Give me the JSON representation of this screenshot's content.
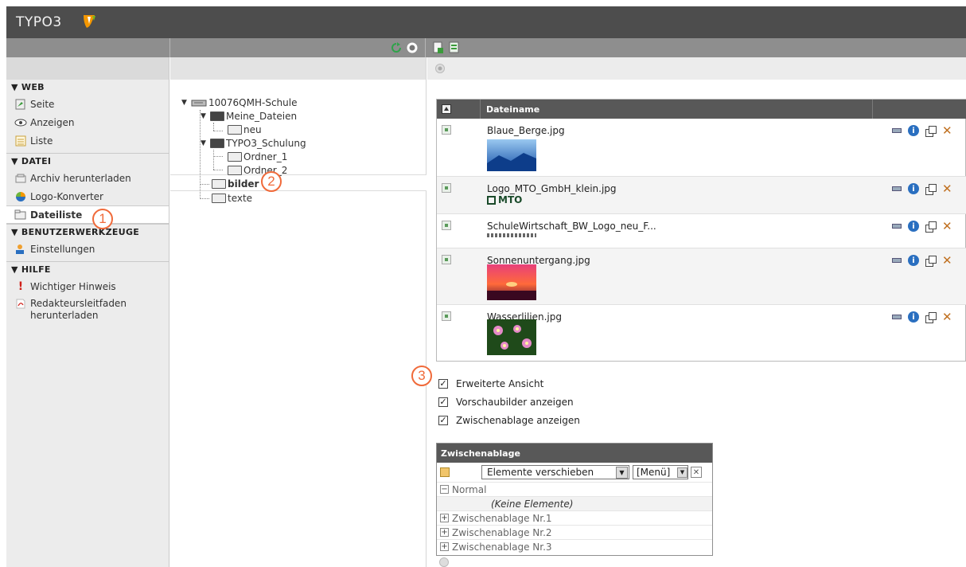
{
  "app": {
    "logo_text": "TYPO3"
  },
  "sidebar": {
    "groups": [
      {
        "title": "▼ WEB",
        "items": [
          {
            "label": "Seite",
            "icon": "page-icon"
          },
          {
            "label": "Anzeigen",
            "icon": "eye-icon"
          },
          {
            "label": "Liste",
            "icon": "list-icon"
          }
        ]
      },
      {
        "title": "▼ DATEI",
        "items": [
          {
            "label": "Archiv herunterladen",
            "icon": "archive-icon"
          },
          {
            "label": "Logo-Konverter",
            "icon": "logo-converter-icon"
          },
          {
            "label": "Dateiliste",
            "icon": "filelist-icon",
            "active": true
          }
        ]
      },
      {
        "title": "▼ BENUTZERWERKZEUGE",
        "items": [
          {
            "label": "Einstellungen",
            "icon": "user-settings-icon"
          }
        ]
      },
      {
        "title": "▼ HILFE",
        "items": [
          {
            "label": "Wichtiger Hinweis",
            "icon": "exclamation-icon"
          },
          {
            "label": "Redakteursleitfaden herunterladen",
            "icon": "pdf-icon"
          }
        ]
      }
    ]
  },
  "tree": {
    "root": "10076QMH-Schule",
    "nodes": [
      "Meine_Dateien",
      "neu",
      "TYPO3_Schulung",
      "Ordner_1",
      "Ordner_2",
      "bilder",
      "texte"
    ]
  },
  "file_table": {
    "column_header": "Dateiname",
    "rows": [
      {
        "name": "Blaue_Berge.jpg"
      },
      {
        "name": "Logo_MTO_GmbH_klein.jpg"
      },
      {
        "name": "SchuleWirtschaft_BW_Logo_neu_F..."
      },
      {
        "name": "Sonnenuntergang.jpg"
      },
      {
        "name": "Wasserlilien.jpg"
      }
    ],
    "logo_thumb_text": "MTO"
  },
  "options": [
    {
      "label": "Erweiterte Ansicht",
      "checked": true
    },
    {
      "label": "Vorschaubilder anzeigen",
      "checked": true
    },
    {
      "label": "Zwischenablage anzeigen",
      "checked": true
    }
  ],
  "clipboard": {
    "title": "Zwischenablage",
    "action_select": "Elemente verschieben",
    "menu_select": "[Menü]",
    "normal_label": "Normal",
    "empty_label": "(Keine Elemente)",
    "pads": [
      "Zwischenablage Nr.1",
      "Zwischenablage Nr.2",
      "Zwischenablage Nr.3"
    ]
  },
  "callouts": [
    "1",
    "2",
    "3"
  ],
  "colors": {
    "accent": "#f06a3a",
    "header_dark": "#4d4d4d",
    "table_head": "#585858"
  }
}
